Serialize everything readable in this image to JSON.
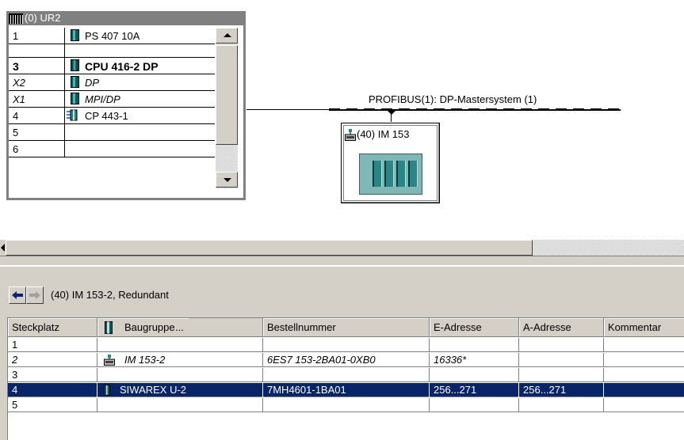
{
  "rack": {
    "title": "(0) UR2",
    "rows": [
      {
        "slot": "1",
        "name": "PS 407 10A",
        "style": "normal",
        "icon": "module-icon"
      },
      {
        "slot": "",
        "name": "",
        "style": "normal",
        "icon": ""
      },
      {
        "slot": "3",
        "name": "CPU 416-2 DP",
        "style": "bold",
        "icon": "cpu-icon"
      },
      {
        "slot": "X2",
        "name": "DP",
        "style": "italic",
        "icon": "module-icon"
      },
      {
        "slot": "X1",
        "name": "MPI/DP",
        "style": "italic",
        "icon": "module-icon"
      },
      {
        "slot": "4",
        "name": "CP 443-1",
        "style": "normal",
        "icon": "network-card-icon"
      },
      {
        "slot": "5",
        "name": "",
        "style": "normal",
        "icon": ""
      },
      {
        "slot": "6",
        "name": "",
        "style": "normal",
        "icon": ""
      }
    ]
  },
  "network": {
    "bus_label": "PROFIBUS(1): DP-Mastersystem (1)",
    "station_label": "(40) IM 153"
  },
  "detail": {
    "title": "(40)  IM 153-2, Redundant",
    "columns": [
      "Steckplatz",
      "Baugruppe",
      "...",
      "Bestellnummer",
      "E-Adresse",
      "A-Adresse",
      "Kommentar"
    ],
    "rows": [
      {
        "slot": "1",
        "module": "",
        "order": "",
        "e_addr": "",
        "a_addr": "",
        "comment": "",
        "style": "normal",
        "icon": ""
      },
      {
        "slot": "2",
        "module": "IM 153-2",
        "order": "6ES7 153-2BA01-0XB0",
        "e_addr": "16336*",
        "a_addr": "",
        "comment": "",
        "style": "italic",
        "icon": "dp-slave-icon"
      },
      {
        "slot": "3",
        "module": "",
        "order": "",
        "e_addr": "",
        "a_addr": "",
        "comment": "",
        "style": "normal",
        "icon": ""
      },
      {
        "slot": "4",
        "module": "SIWAREX U-2",
        "order": "7MH4601-1BA01",
        "e_addr": "256...271",
        "a_addr": "256...271",
        "comment": "",
        "style": "selected",
        "icon": "module-icon"
      },
      {
        "slot": "5",
        "module": "",
        "order": "",
        "e_addr": "",
        "a_addr": "",
        "comment": "",
        "style": "normal",
        "icon": ""
      }
    ]
  },
  "colors": {
    "selection": "#0a246a",
    "window_face": "#d4d0c8",
    "titlebar": "#808080",
    "module_teal": "#2a8585"
  }
}
